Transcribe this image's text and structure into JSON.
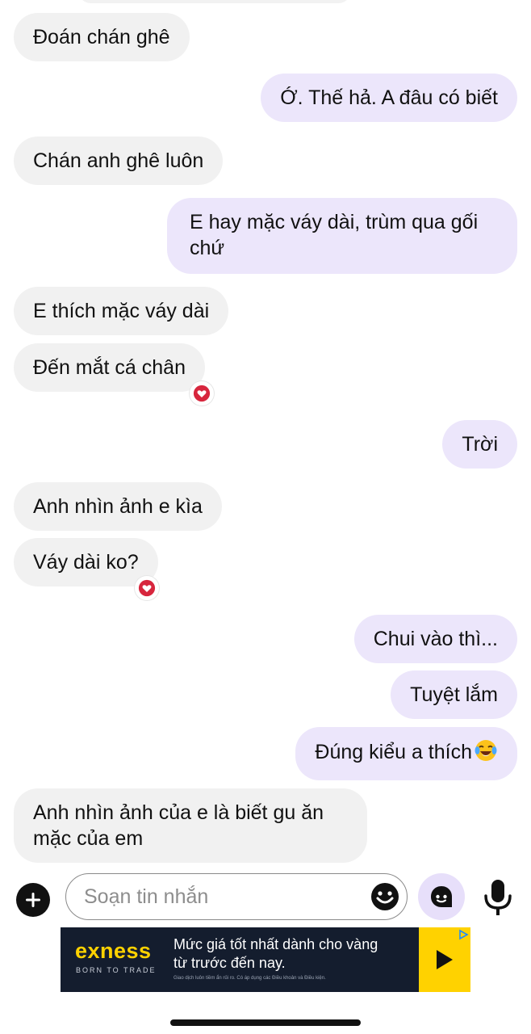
{
  "messages": [
    {
      "side": "in",
      "text": "Đoán chán ghê"
    },
    {
      "side": "out",
      "text": "Ớ. Thế hả. A đâu có biết"
    },
    {
      "side": "in",
      "text": "Chán anh ghê luôn"
    },
    {
      "side": "out",
      "text": "E hay mặc váy dài, trùm qua gối chứ"
    },
    {
      "side": "in",
      "text": "E thích mặc váy dài"
    },
    {
      "side": "in",
      "text": "Đến mắt cá chân",
      "reaction": "heart"
    },
    {
      "side": "out",
      "text": "Trời"
    },
    {
      "side": "in",
      "text": "Anh nhìn ảnh e kìa"
    },
    {
      "side": "in",
      "text": "Váy dài ko?",
      "reaction": "heart"
    },
    {
      "side": "out",
      "text": "Chui vào thì..."
    },
    {
      "side": "out",
      "text": "Tuyệt lắm"
    },
    {
      "side": "out",
      "text": "Đúng kiểu a thích",
      "emoji": "tears-of-joy-emoji"
    },
    {
      "side": "in",
      "text": "Anh nhìn ảnh của e là biết gu ăn mặc của em"
    }
  ],
  "composer": {
    "placeholder": "Soạn tin nhắn",
    "icons": [
      "plus-icon",
      "smiley-icon",
      "assistant-icon",
      "microphone-icon"
    ]
  },
  "ad": {
    "brand": "exness",
    "tagline": "BORN TO TRADE",
    "headline": "Mức giá tốt nhất dành cho vàng từ trước đến nay.",
    "fineprint": "Giao dịch luôn tiềm ẩn rủi ro. Có áp dụng các Điều khoản và Điều kiện.",
    "icons": [
      "play-icon",
      "adchoices-icon"
    ]
  },
  "colors": {
    "incoming_bubble": "#f1f1f1",
    "outgoing_bubble": "#ece6fb",
    "ad_background": "#141d2e",
    "ad_accent": "#ffd200",
    "reaction": "#d7263d"
  }
}
